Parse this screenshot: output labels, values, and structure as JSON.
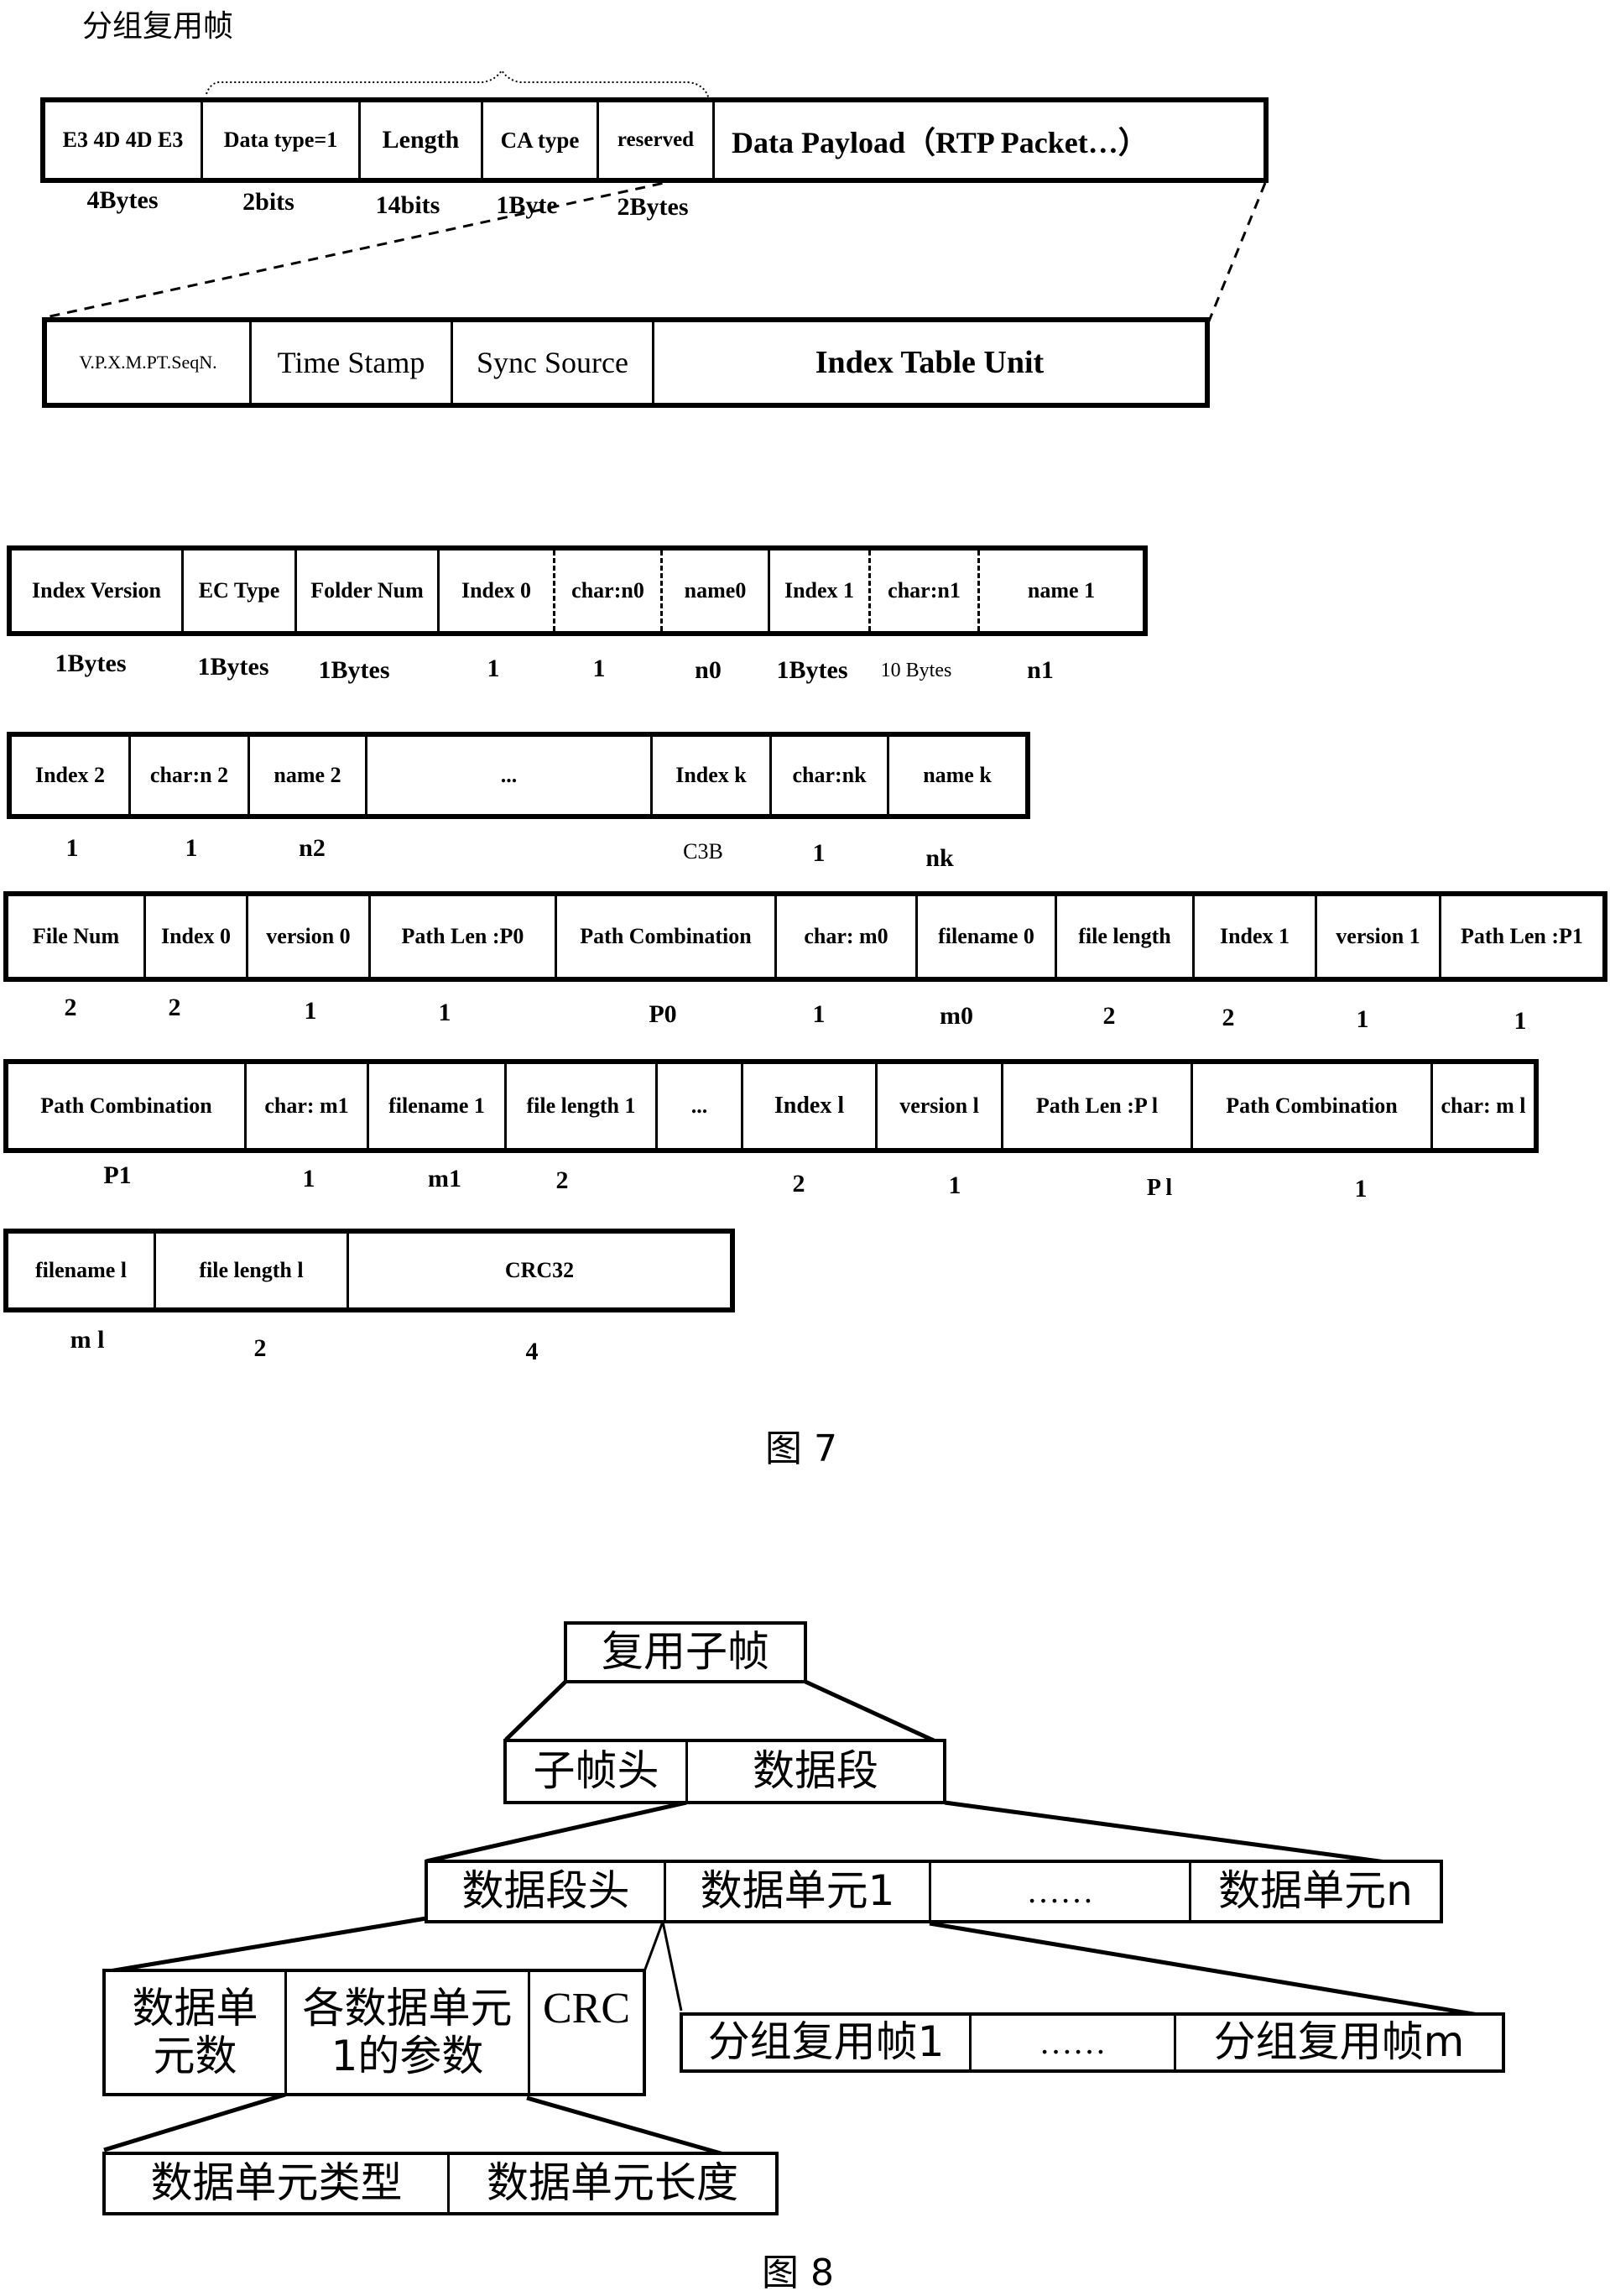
{
  "fig7": {
    "title": "分组复用帧",
    "caption": "图 7",
    "frame_row": {
      "cells": [
        "E3 4D 4D E3",
        "Data type=1",
        "Length",
        "CA type",
        "reserved",
        "Data Payload（RTP Packet…）"
      ],
      "sizes": [
        "4Bytes",
        "2bits",
        "14bits",
        "1Byte",
        "2Bytes"
      ]
    },
    "rtp_row": {
      "cells": [
        "V.P.X.M.PT.SeqN.",
        "Time Stamp",
        "Sync Source",
        "Index Table Unit"
      ]
    },
    "index_row1": {
      "cells": [
        "Index Version",
        "EC Type",
        "Folder Num",
        "Index 0",
        "char:n0",
        "name0",
        "Index 1",
        "char:n1",
        "name 1"
      ],
      "sizes": [
        "1Bytes",
        "1Bytes",
        "1Bytes",
        "1",
        "1",
        "n0",
        "1Bytes",
        "10 Bytes",
        "n1"
      ]
    },
    "index_row2": {
      "cells": [
        "Index 2",
        "char:n 2",
        "name 2",
        "...",
        "Index k",
        "char:nk",
        "name k"
      ],
      "sizes": [
        "1",
        "1",
        "n2",
        "",
        "C3B",
        "1",
        "nk"
      ]
    },
    "file_row1": {
      "cells": [
        "File Num",
        "Index 0",
        "version 0",
        "Path Len :P0",
        "Path Combination",
        "char: m0",
        "filename 0",
        "file length",
        "Index 1",
        "version 1",
        "Path Len :P1"
      ],
      "sizes": [
        "2",
        "2",
        "1",
        "1",
        "P0",
        "1",
        "m0",
        "2",
        "2",
        "1",
        "1"
      ]
    },
    "file_row2": {
      "cells": [
        "Path Combination",
        "char: m1",
        "filename 1",
        "file length 1",
        "...",
        "Index l",
        "version l",
        "Path Len :P l",
        "Path Combination",
        "char: m l"
      ],
      "sizes": [
        "P1",
        "1",
        "m1",
        "2",
        "",
        "2",
        "1",
        "P l",
        "1",
        ""
      ]
    },
    "file_row3": {
      "cells": [
        "filename l",
        "file length l",
        "CRC32"
      ],
      "sizes": [
        "m l",
        "2",
        "4"
      ]
    }
  },
  "fig8": {
    "caption": "图 8",
    "root": "复用子帧",
    "level1": [
      "子帧头",
      "数据段"
    ],
    "level2": [
      "数据段头",
      "数据单元1",
      "……",
      "数据单元n"
    ],
    "level3_header": [
      "数据单元数",
      "各数据单元1的参数",
      "CRC"
    ],
    "level3_unit": [
      "分组复用帧1",
      "……",
      "分组复用帧m"
    ],
    "level4": [
      "数据单元类型",
      "数据单元长度"
    ]
  }
}
